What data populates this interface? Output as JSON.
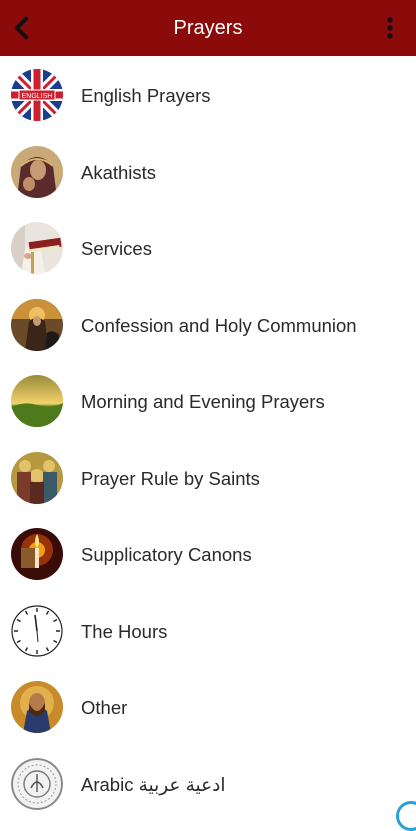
{
  "appbar": {
    "title": "Prayers",
    "back_icon": "chevron-left-icon",
    "menu_icon": "more-vertical-icon",
    "color": "#8b0a0a"
  },
  "items": [
    {
      "label": "English Prayers",
      "icon": "uk-flag-icon",
      "badge": "ENGLISH"
    },
    {
      "label": "Akathists",
      "icon": "theotokos-icon"
    },
    {
      "label": "Services",
      "icon": "priest-book-icon"
    },
    {
      "label": "Confession and Holy Communion",
      "icon": "confession-icon"
    },
    {
      "label": "Morning and Evening Prayers",
      "icon": "sunrise-landscape-icon"
    },
    {
      "label": "Prayer Rule by Saints",
      "icon": "saints-icon"
    },
    {
      "label": "Supplicatory Canons",
      "icon": "candle-icon"
    },
    {
      "label": "The Hours",
      "icon": "clock-icon"
    },
    {
      "label": "Other",
      "icon": "christ-icon"
    },
    {
      "label": "Arabic ادعية عربية",
      "icon": "arabic-seal-icon"
    }
  ]
}
